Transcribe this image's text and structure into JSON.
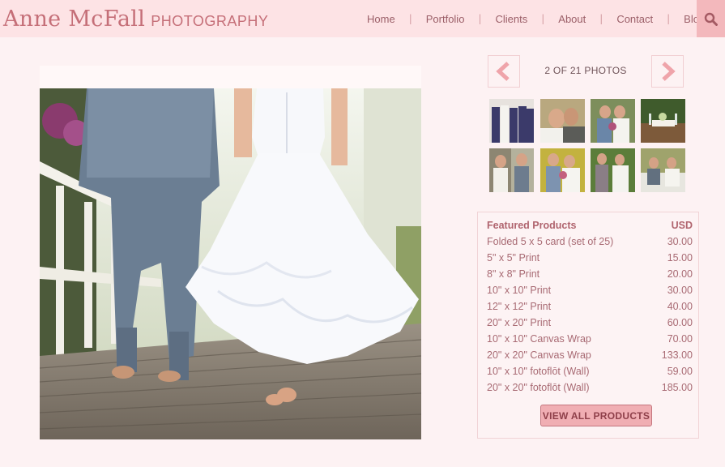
{
  "brand": {
    "name": "Anne McFall",
    "tagline": "PHOTOGRAPHY"
  },
  "nav": {
    "items": [
      "Home",
      "Portfolio",
      "Clients",
      "About",
      "Contact",
      "Blog"
    ],
    "separator": "|",
    "search_icon": "magnifier-icon"
  },
  "gallery": {
    "prev_icon": "chevron-left-icon",
    "next_icon": "chevron-right-icon",
    "count_label": "2 OF 21 PHOTOS"
  },
  "products": {
    "header_label": "Featured Products",
    "currency": "USD",
    "items": [
      {
        "name": "Folded 5 x 5 card (set of 25)",
        "price": "30.00"
      },
      {
        "name": "5\" x 5\" Print",
        "price": "15.00"
      },
      {
        "name": "8\" x 8\" Print",
        "price": "20.00"
      },
      {
        "name": "10\" x 10\" Print",
        "price": "30.00"
      },
      {
        "name": "12\" x 12\" Print",
        "price": "40.00"
      },
      {
        "name": "20\" x 20\" Print",
        "price": "60.00"
      },
      {
        "name": "10\" x 10\" Canvas Wrap",
        "price": "70.00"
      },
      {
        "name": "20\" x 20\" Canvas Wrap",
        "price": "133.00"
      },
      {
        "name": "10\" x 10\" fotoflōt (Wall)",
        "price": "59.00"
      },
      {
        "name": "20\" x 20\" fotoflōt (Wall)",
        "price": "185.00"
      }
    ],
    "view_all_label": "VIEW ALL PRODUCTS"
  },
  "colors": {
    "accent": "#c56f78",
    "header_bg": "#fde3e5",
    "search_bg": "#f3b8bc",
    "page_bg": "#fdf2f3"
  }
}
